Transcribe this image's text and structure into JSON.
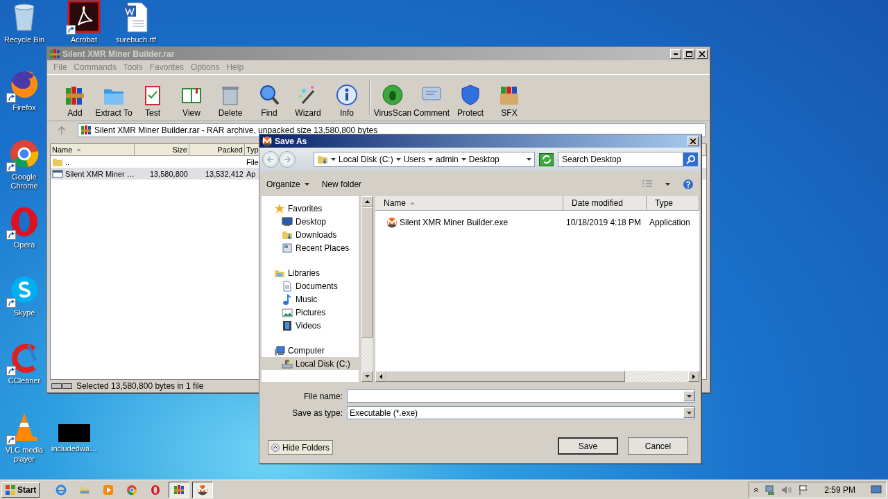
{
  "desktop_icons": [
    {
      "label": "Recycle Bin",
      "kind": "recycle"
    },
    {
      "label": "Acrobat",
      "kind": "pdf"
    },
    {
      "label": "surebuch.rtf",
      "kind": "word"
    },
    {
      "label": "Firefox",
      "kind": "firefox"
    },
    {
      "label": "Google Chrome",
      "kind": "chrome"
    },
    {
      "label": "Opera",
      "kind": "opera"
    },
    {
      "label": "Skype",
      "kind": "skype"
    },
    {
      "label": "CCleaner",
      "kind": "ccleaner"
    },
    {
      "label": "VLC media player",
      "kind": "vlc"
    },
    {
      "label": "includedwa…",
      "kind": "blank"
    }
  ],
  "winrar": {
    "title": "Silent XMR Miner Builder.rar",
    "menu": [
      "File",
      "Commands",
      "Tools",
      "Favorites",
      "Options",
      "Help"
    ],
    "toolbar": [
      "Add",
      "Extract To",
      "Test",
      "View",
      "Delete",
      "Find",
      "Wizard",
      "Info",
      "VirusScan",
      "Comment",
      "Protect",
      "SFX"
    ],
    "address": "Silent XMR Miner Builder.rar - RAR archive, unpacked size 13,580,800 bytes",
    "columns": [
      "Name",
      "Size",
      "Packed",
      "Typ"
    ],
    "rows": [
      {
        "kind": "folder",
        "name": "..",
        "type": "File",
        "selected": false
      },
      {
        "kind": "file",
        "name": "Silent XMR Miner …",
        "size": "13,580,800",
        "packed": "13,532,412",
        "type": "Ap",
        "selected": true
      }
    ],
    "status": "Selected 13,580,800 bytes in 1 file"
  },
  "save_as": {
    "title": "Save As",
    "breadcrumb": [
      "Local Disk (C:)",
      "Users",
      "admin",
      "Desktop"
    ],
    "search": {
      "placeholder": "Search Desktop"
    },
    "commands": [
      "Organize",
      "New folder"
    ],
    "sidebar": [
      {
        "label": "Favorites",
        "kind": "star",
        "children": [
          {
            "label": "Desktop",
            "kind": "desktop",
            "selected": false
          },
          {
            "label": "Downloads",
            "kind": "downloads",
            "selected": false
          },
          {
            "label": "Recent Places",
            "kind": "recent",
            "selected": false
          }
        ]
      },
      {
        "label": "Libraries",
        "kind": "library",
        "children": [
          {
            "label": "Documents",
            "kind": "documents",
            "selected": false
          },
          {
            "label": "Music",
            "kind": "music",
            "selected": false
          },
          {
            "label": "Pictures",
            "kind": "pictures",
            "selected": false
          },
          {
            "label": "Videos",
            "kind": "videos",
            "selected": false
          }
        ]
      },
      {
        "label": "Computer",
        "kind": "computer",
        "children": [
          {
            "label": "Local Disk (C:)",
            "kind": "disk",
            "selected": true
          }
        ]
      }
    ],
    "columns": [
      "Name",
      "Date modified",
      "Type"
    ],
    "files": [
      {
        "name": "Silent XMR Miner Builder.exe",
        "date": "10/18/2019 4:18 PM",
        "type": "Application"
      }
    ],
    "fields": [
      {
        "label": "File name:"
      },
      {
        "label": "Save as type:",
        "value": "Executable  (*.exe)"
      }
    ],
    "hide_folders": "Hide Folders",
    "buttons": [
      "Save",
      "Cancel"
    ]
  },
  "taskbar": {
    "start": "Start",
    "apps": [
      {
        "kind": "ie",
        "open": false
      },
      {
        "kind": "explorer",
        "open": false
      },
      {
        "kind": "media",
        "open": false
      },
      {
        "kind": "chrome",
        "open": false
      },
      {
        "kind": "opera",
        "open": false
      },
      {
        "kind": "winrar",
        "open": true
      },
      {
        "kind": "monero",
        "open": true
      }
    ],
    "clock": "2:59 PM"
  }
}
